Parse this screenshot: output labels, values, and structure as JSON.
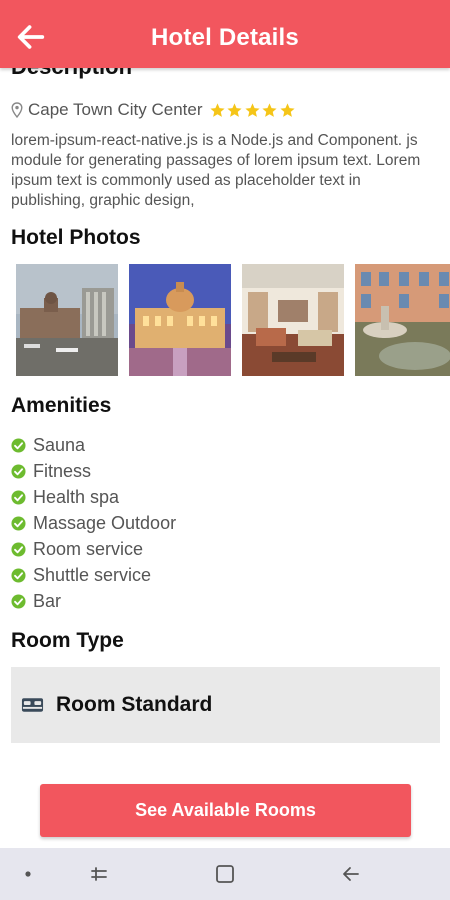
{
  "header": {
    "title": "Hotel Details",
    "back_icon": "arrow-left-icon",
    "color": "#f2565e"
  },
  "description": {
    "heading": "Description",
    "location": "Cape Town City Center",
    "rating": 5,
    "text": "lorem-ipsum-react-native.js is a Node.js and Component. js module for generating passages of lorem ipsum text. Lorem ipsum text is commonly used as placeholder text in publishing, graphic design,"
  },
  "photos": {
    "heading": "Hotel Photos",
    "items": [
      "harbor-hotel-photo",
      "palace-hotel-photo",
      "hotel-lobby-photo",
      "courtyard-fountain-photo"
    ]
  },
  "amenities": {
    "heading": "Amenities",
    "items": [
      "Sauna",
      "Fitness",
      "Health spa",
      "Massage Outdoor",
      "Room service",
      "Shuttle service",
      "Bar"
    ]
  },
  "room_type": {
    "heading": "Room Type",
    "room": "Room Standard",
    "icon": "bed-icon"
  },
  "cta": {
    "label": "See Available Rooms"
  },
  "colors": {
    "accent": "#f2565e",
    "star": "#f5c518",
    "check": "#6dbb2f"
  },
  "nav_bar": {
    "icons": [
      "dot-icon",
      "recent-apps-icon",
      "home-square-icon",
      "back-icon"
    ]
  }
}
